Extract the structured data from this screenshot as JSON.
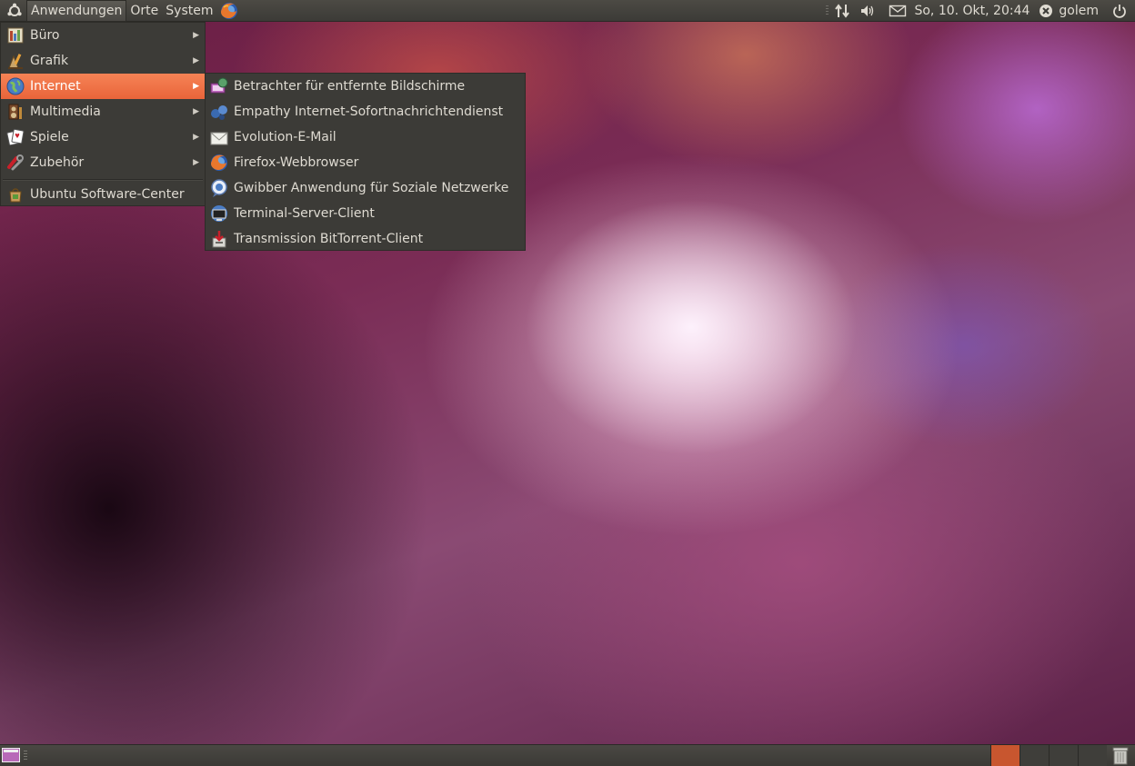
{
  "top_panel": {
    "menus": [
      "Anwendungen",
      "Orte",
      "System"
    ],
    "clock": "So, 10. Okt, 20:44",
    "user": "golem"
  },
  "main_menu": {
    "items": [
      {
        "label": "Büro",
        "icon": "office-icon"
      },
      {
        "label": "Grafik",
        "icon": "graphics-icon"
      },
      {
        "label": "Internet",
        "icon": "internet-globe-icon"
      },
      {
        "label": "Multimedia",
        "icon": "multimedia-icon"
      },
      {
        "label": "Spiele",
        "icon": "games-cards-icon"
      },
      {
        "label": "Zubehör",
        "icon": "accessories-icon"
      }
    ],
    "software_center": "Ubuntu Software-Center"
  },
  "internet_submenu": {
    "items": [
      {
        "label": "Betrachter für entfernte Bildschirme",
        "icon": "remote-desktop-icon"
      },
      {
        "label": "Empathy Internet-Sofortnachrichtendienst",
        "icon": "empathy-icon"
      },
      {
        "label": "Evolution-E-Mail",
        "icon": "evolution-mail-icon"
      },
      {
        "label": "Firefox-Webbrowser",
        "icon": "firefox-icon"
      },
      {
        "label": "Gwibber Anwendung für Soziale Netzwerke",
        "icon": "gwibber-icon"
      },
      {
        "label": "Terminal-Server-Client",
        "icon": "terminal-server-icon"
      },
      {
        "label": "Transmission BitTorrent-Client",
        "icon": "transmission-icon"
      }
    ]
  },
  "colors": {
    "panel": "#3c3b37",
    "highlight": "#f07746",
    "workspace_active": "#c8562f"
  }
}
